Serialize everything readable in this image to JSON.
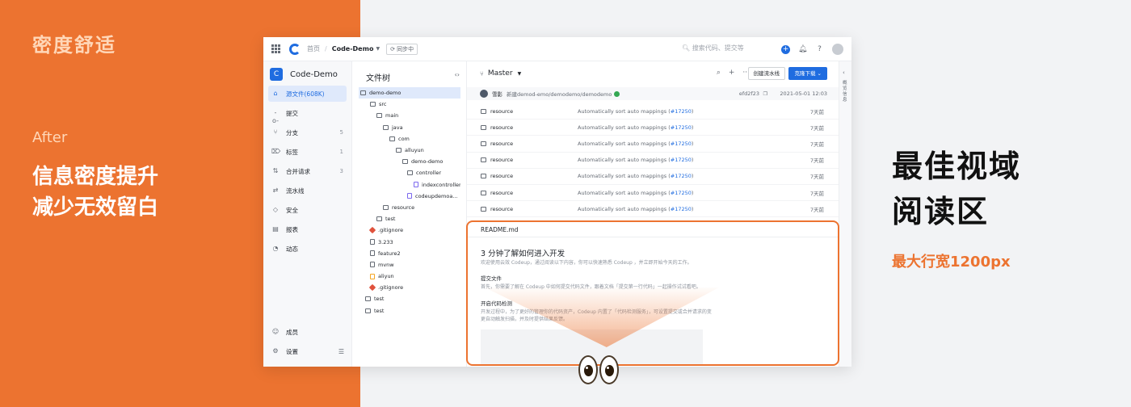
{
  "colors": {
    "accent": "#ec7330",
    "brand_blue": "#1f6ce0",
    "bg_right": "#f2f3f5"
  },
  "promo": {
    "brand_title": "密度舒适",
    "after_label": "After",
    "headline_lines": [
      "信息密度提升",
      "减少无效留白"
    ],
    "right_headline_lines": [
      "最佳视域",
      "阅读区"
    ],
    "right_sub": "最大行宽1200px"
  },
  "topbar": {
    "home": "首页",
    "separator": "/",
    "repo": "Code-Demo",
    "sync_badge": "同步中",
    "search_placeholder": "搜索代码、提交等",
    "icons": [
      "plus-icon",
      "bell-icon",
      "help-icon",
      "avatar"
    ]
  },
  "sidebar": {
    "repo_badge": "C",
    "repo_name": "Code-Demo",
    "items": [
      {
        "label": "源文件(608K)",
        "icon": "home-icon",
        "count": ""
      },
      {
        "label": "提交",
        "icon": "commit-icon",
        "count": ""
      },
      {
        "label": "分支",
        "icon": "branch-icon",
        "count": "5"
      },
      {
        "label": "标签",
        "icon": "tag-icon",
        "count": "1"
      },
      {
        "label": "合并请求",
        "icon": "merge-icon",
        "count": "3"
      },
      {
        "label": "流水线",
        "icon": "pipeline-icon",
        "count": ""
      },
      {
        "label": "安全",
        "icon": "shield-icon",
        "count": ""
      },
      {
        "label": "报表",
        "icon": "report-icon",
        "count": ""
      },
      {
        "label": "动态",
        "icon": "activity-icon",
        "count": ""
      }
    ],
    "bottom_items": [
      {
        "label": "成员",
        "icon": "user-icon"
      },
      {
        "label": "设置",
        "icon": "gear-icon"
      }
    ]
  },
  "filetree": {
    "title": "文件树",
    "rows": [
      {
        "name": "demo-demo",
        "depth": 0,
        "type": "folder"
      },
      {
        "name": "src",
        "depth": 1,
        "type": "folder"
      },
      {
        "name": "main",
        "depth": 2,
        "type": "folder"
      },
      {
        "name": "java",
        "depth": 3,
        "type": "folder"
      },
      {
        "name": "com",
        "depth": 4,
        "type": "folder"
      },
      {
        "name": "alluyun",
        "depth": 5,
        "type": "folder"
      },
      {
        "name": "demo-demo",
        "depth": 6,
        "type": "folder"
      },
      {
        "name": "controller",
        "depth": 7,
        "type": "folder"
      },
      {
        "name": "indexcontroller",
        "depth": 8,
        "type": "java"
      },
      {
        "name": "codeupdemoa...",
        "depth": 7,
        "type": "java"
      },
      {
        "name": "resource",
        "depth": 3,
        "type": "folder"
      },
      {
        "name": "test",
        "depth": 2,
        "type": "folder"
      },
      {
        "name": ".gitignore",
        "depth": 1,
        "type": "git"
      },
      {
        "name": "3.233",
        "depth": 1,
        "type": "file"
      },
      {
        "name": "feature2",
        "depth": 1,
        "type": "file"
      },
      {
        "name": "mvnw",
        "depth": 1,
        "type": "file"
      },
      {
        "name": "aliyun",
        "depth": 1,
        "type": "orange"
      },
      {
        "name": ".gitignore",
        "depth": 1,
        "type": "git"
      },
      {
        "name": "test",
        "depth": 0,
        "type": "folder"
      },
      {
        "name": "test",
        "depth": 0,
        "type": "folder"
      }
    ]
  },
  "main": {
    "branch": "Master",
    "tools": [
      "search-icon",
      "plus-icon",
      "more-icon"
    ],
    "pipeline_button": "创建流水线",
    "clone_button": "克隆下载",
    "commit": {
      "user": "雪影",
      "message": "新建demod-emo/demodemo/demodemo",
      "hash": "efd2f23",
      "date": "2021-05-01 12:03"
    },
    "files": [
      {
        "name": "resource",
        "message": "Automatically sort auto mappings (",
        "link": "#17250",
        "suffix": ")",
        "time": "7天前"
      },
      {
        "name": "resource",
        "message": "Automatically sort auto mappings (",
        "link": "#17250",
        "suffix": ")",
        "time": "7天前"
      },
      {
        "name": "resource",
        "message": "Automatically sort auto mappings (",
        "link": "#17250",
        "suffix": ")",
        "time": "7天前"
      },
      {
        "name": "resource",
        "message": "Automatically sort auto mappings (",
        "link": "#17250",
        "suffix": ")",
        "time": "7天前"
      },
      {
        "name": "resource",
        "message": "Automatically sort auto mappings (",
        "link": "#17250",
        "suffix": ")",
        "time": "7天前"
      },
      {
        "name": "resource",
        "message": "Automatically sort auto mappings (",
        "link": "#17250",
        "suffix": ")",
        "time": "7天前"
      },
      {
        "name": "resource",
        "message": "Automatically sort auto mappings (",
        "link": "#17250",
        "suffix": ")",
        "time": "7天前"
      }
    ]
  },
  "readme": {
    "title": "README.md",
    "h1": "3 分钟了解如何进入开发",
    "intro": "欢迎使用云效 Codeup，通过阅读以下内容，你可以快速熟悉 Codeup ，并立即开始今天的工作。",
    "sec1_title": "提交文件",
    "sec1_text": "首先，你需要了解在 Codeup 中如何提交代码文件，跟着文档「提交第一行代码」一起操作试试看吧。",
    "sec2_title": "开启代码检测",
    "sec2_text": "开发过程中，为了更好的管理你的代码资产，Codeup 内置了「代码检测服务」，可设置提交或合并请求的变更自动触发扫描，并及时提供结果反馈。"
  },
  "right_rail": {
    "text": "概览信息"
  }
}
